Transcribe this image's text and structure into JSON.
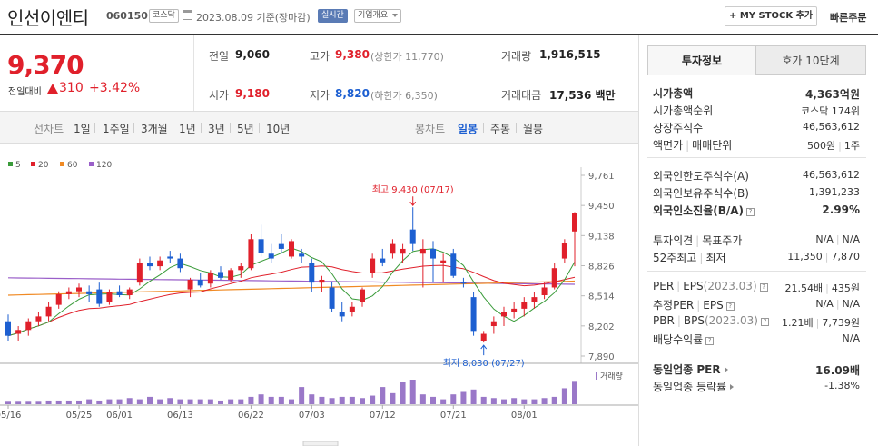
{
  "header": {
    "company_name": "인선이엔티",
    "code": "060150",
    "market_badge": "코스닥",
    "date_text": "2023.08.09  기준(장마감)",
    "live_badge": "실시간",
    "info_badge": "기업개요",
    "mystock_label": "+ MY STOCK 추가",
    "quick_order": "빠른주문"
  },
  "quote": {
    "price": "9,370",
    "change_label": "전일대비",
    "change": "310",
    "change_pct": "+3.42%",
    "prev_label": "전일",
    "prev": "9,060",
    "high_label": "고가",
    "high": "9,380",
    "upper_limit": "(상한가 11,770)",
    "volume_label": "거래량",
    "volume": "1,916,515",
    "open_label": "시가",
    "open": "9,180",
    "low_label": "저가",
    "low": "8,820",
    "lower_limit": "(하한가 6,350)",
    "amount_label": "거래대금",
    "amount": "17,536 백만"
  },
  "chart_tabs": {
    "line_chart": "선차트",
    "periods": [
      "1일",
      "1주일",
      "3개월",
      "1년",
      "3년",
      "5년",
      "10년"
    ],
    "candle_chart": "봉차트",
    "candles": [
      "일봉",
      "주봉",
      "월봉"
    ],
    "active_candle": "일봉"
  },
  "colors": {
    "up": "#e0202b",
    "down": "#1d5fd1",
    "ma5": "#3a9b3a",
    "ma20": "#e0202b",
    "ma60": "#f08a24",
    "ma120": "#9a5fc9",
    "volume": "#9a78c8"
  },
  "chart_data": {
    "type": "candlestick",
    "ma_legend": [
      "5",
      "20",
      "60",
      "120"
    ],
    "y_ticks": [
      "9,761",
      "9,450",
      "9,138",
      "8,826",
      "8,514",
      "8,202",
      "7,890"
    ],
    "ylim": [
      7890,
      9761
    ],
    "x_ticks": [
      {
        "label": "05/16",
        "index": 0
      },
      {
        "label": "05/25",
        "index": 7
      },
      {
        "label": "06/01",
        "index": 11
      },
      {
        "label": "06/13",
        "index": 17
      },
      {
        "label": "06/22",
        "index": 24
      },
      {
        "label": "07/03",
        "index": 30
      },
      {
        "label": "07/12",
        "index": 37
      },
      {
        "label": "07/21",
        "index": 44
      },
      {
        "label": "08/01",
        "index": 51
      }
    ],
    "high_annotation": {
      "label": "최고 9,430 (07/17)",
      "index": 40,
      "value": 9430
    },
    "low_annotation": {
      "label": "최저 8,030 (07/27)",
      "index": 47,
      "value": 8030
    },
    "volume_label": "거래량",
    "candles": [
      [
        8250,
        8320,
        8050,
        8100
      ],
      [
        8120,
        8200,
        8050,
        8160
      ],
      [
        8160,
        8280,
        8100,
        8250
      ],
      [
        8250,
        8350,
        8200,
        8300
      ],
      [
        8300,
        8450,
        8250,
        8400
      ],
      [
        8420,
        8560,
        8380,
        8530
      ],
      [
        8530,
        8600,
        8480,
        8560
      ],
      [
        8560,
        8640,
        8500,
        8600
      ],
      [
        8560,
        8620,
        8450,
        8530
      ],
      [
        8580,
        8650,
        8400,
        8430
      ],
      [
        8450,
        8580,
        8420,
        8550
      ],
      [
        8560,
        8620,
        8500,
        8520
      ],
      [
        8520,
        8600,
        8480,
        8580
      ],
      [
        8650,
        8900,
        8620,
        8850
      ],
      [
        8850,
        8920,
        8780,
        8820
      ],
      [
        8820,
        8920,
        8780,
        8880
      ],
      [
        8920,
        8980,
        8850,
        8900
      ],
      [
        8900,
        8950,
        8760,
        8800
      ],
      [
        8580,
        8700,
        8500,
        8680
      ],
      [
        8680,
        8750,
        8600,
        8620
      ],
      [
        8640,
        8780,
        8600,
        8750
      ],
      [
        8760,
        8820,
        8680,
        8700
      ],
      [
        8680,
        8800,
        8650,
        8780
      ],
      [
        8780,
        8850,
        8700,
        8820
      ],
      [
        8800,
        9150,
        8780,
        9100
      ],
      [
        9100,
        9250,
        8920,
        8960
      ],
      [
        8950,
        9050,
        8850,
        8900
      ],
      [
        9050,
        9150,
        8950,
        9000
      ],
      [
        8920,
        9100,
        8900,
        9080
      ],
      [
        8950,
        9000,
        8850,
        8920
      ],
      [
        8850,
        8900,
        8550,
        8650
      ],
      [
        8650,
        8720,
        8550,
        8680
      ],
      [
        8600,
        8660,
        8350,
        8380
      ],
      [
        8350,
        8450,
        8250,
        8300
      ],
      [
        8350,
        8450,
        8300,
        8400
      ],
      [
        8450,
        8600,
        8400,
        8580
      ],
      [
        8750,
        8950,
        8700,
        8900
      ],
      [
        8900,
        9000,
        8820,
        8860
      ],
      [
        8950,
        9100,
        8900,
        9050
      ],
      [
        8950,
        9050,
        8850,
        9000
      ],
      [
        9200,
        9430,
        8980,
        9050
      ],
      [
        8950,
        9100,
        8600,
        9000
      ],
      [
        9000,
        9080,
        8650,
        8900
      ],
      [
        8850,
        8950,
        8650,
        8880
      ],
      [
        8950,
        9000,
        8700,
        8720
      ],
      [
        8650,
        8700,
        8600,
        8640
      ],
      [
        8500,
        8550,
        8100,
        8150
      ],
      [
        8050,
        8150,
        8030,
        8120
      ],
      [
        8200,
        8300,
        8120,
        8250
      ],
      [
        8300,
        8400,
        8200,
        8350
      ],
      [
        8350,
        8450,
        8280,
        8380
      ],
      [
        8380,
        8500,
        8300,
        8450
      ],
      [
        8450,
        8550,
        8380,
        8500
      ],
      [
        8520,
        8650,
        8480,
        8600
      ],
      [
        8600,
        8850,
        8580,
        8800
      ],
      [
        8900,
        9100,
        8850,
        9060
      ],
      [
        9180,
        9380,
        8820,
        9370
      ]
    ],
    "volumes": [
      2,
      2,
      2,
      2,
      3,
      3,
      3,
      3,
      4,
      3,
      4,
      4,
      5,
      4,
      6,
      4,
      5,
      4,
      4,
      4,
      4,
      3,
      4,
      4,
      6,
      8,
      6,
      6,
      4,
      14,
      8,
      6,
      5,
      6,
      6,
      5,
      7,
      14,
      9,
      18,
      20,
      8,
      6,
      4,
      8,
      10,
      12,
      6,
      5,
      4,
      5,
      4,
      4,
      5,
      6,
      13,
      19
    ]
  },
  "right_panel": {
    "tab_invest": "투자정보",
    "tab_orderbook": "호가 10단계",
    "rows_a": [
      {
        "label": "시가총액",
        "value": "4,363억원"
      },
      {
        "label": "시가총액순위",
        "value": "코스닥 174위"
      },
      {
        "label": "상장주식수",
        "value": "46,563,612"
      },
      {
        "label": "액면가",
        "label2": "매매단위",
        "value": "500원",
        "value2": "1주"
      }
    ],
    "rows_b": [
      {
        "label": "외국인한도주식수(A)",
        "value": "46,563,612"
      },
      {
        "label": "외국인보유주식수(B)",
        "value": "1,391,233"
      },
      {
        "label": "외국인소진율(B/A)",
        "value": "2.99%"
      }
    ],
    "rows_c": [
      {
        "label": "투자의견",
        "label2": "목표주가",
        "value": "N/A",
        "value2": "N/A"
      },
      {
        "label": "52주최고",
        "label2": "최저",
        "value": "11,350",
        "value2": "7,870"
      }
    ],
    "rows_d": [
      {
        "label": "PER",
        "label2": "EPS",
        "sub": "(2023.03)",
        "value": "21.54배",
        "value2": "435원"
      },
      {
        "label": "추정PER",
        "label2": "EPS",
        "value": "N/A",
        "value2": "N/A"
      },
      {
        "label": "PBR",
        "label2": "BPS",
        "sub": "(2023.03)",
        "value": "1.21배",
        "value2": "7,739원"
      },
      {
        "label": "배당수익률",
        "value": "N/A"
      }
    ],
    "rows_e": [
      {
        "label": "동일업종 PER",
        "value": "16.09배"
      },
      {
        "label": "동일업종 등락률",
        "value": "-1.38%"
      }
    ]
  }
}
